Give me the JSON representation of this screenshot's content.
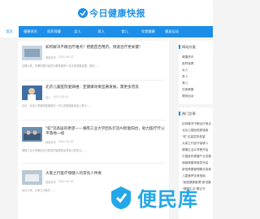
{
  "logo": {
    "text": "今日健康快报"
  },
  "nav": {
    "items": [
      "首页",
      "健康资讯",
      "医药保健",
      "女人",
      "男人",
      "育儿",
      "饮食健康",
      "健身运动"
    ],
    "active": 0
  },
  "articles": [
    {
      "title": "如何解决不眠治疗难点？把握首百用药，快速治疗更关键！",
      "meta": [
        "健康资讯",
        "2021-09-13"
      ],
      "summary": "近期以来，失眠问题已经成为越来越多人关注的健康话题，如何……"
    },
    {
      "title": "北京儿童医院麦娣维：亚健康效果显著发展，需更多普及",
      "meta": [
        "男人",
        "2021-09-18"
      ],
      "summary": "近日，北京儿童医院麦娣维在一次儿童健康座谈会上表示……"
    },
    {
      "title": "\"驼\"见高层的希望——湖南工业大学团队打造AI智能阳台，助力医疗疗公平落地一线",
      "meta": [
        "健康资讯",
        "2021-09-16"
      ],
      "summary": "湖南工业大学团队近日研发的智能阳台项目引发关注……"
    },
    {
      "title": "大家之行医疗保健人的李亮人伴奏",
      "meta": [
        "健康资讯",
        "2021-09-16"
      ],
      "summary": "近日以来，大家之行医疗……"
    }
  ],
  "sidebar1": {
    "title": "网站分类",
    "items": [
      "健康资讯",
      "医药保健",
      "女人",
      "男人",
      "育儿",
      "饮食健康",
      "健身运动"
    ]
  },
  "sidebar2": {
    "title": "热门文章",
    "items": [
      "如何解决不眠治疗难点",
      "北京儿童医院麦娣维",
      "\"驼\"见高层的希望",
      "大家之行医疗保健人",
      "健康生活从早餐开始",
      "中国医药健康产业发展",
      "湖南健康快报发布会",
      "新型健康管理模式探索",
      "儿童营养饮食指南",
      "\"我国健康管理\"新进展",
      "\"健康生活\"倡议书"
    ]
  },
  "watermark": {
    "text": "便民库"
  }
}
